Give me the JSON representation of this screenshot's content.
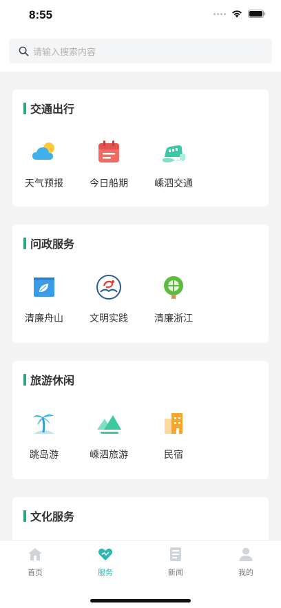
{
  "status_bar": {
    "time": "8:55"
  },
  "search": {
    "placeholder": "请输入搜索内容"
  },
  "sections": [
    {
      "title": "交通出行",
      "items": [
        {
          "label": "天气预报",
          "icon": "weather-icon"
        },
        {
          "label": "今日船期",
          "icon": "calendar-icon"
        },
        {
          "label": "嵊泗交通",
          "icon": "ship-icon"
        }
      ]
    },
    {
      "title": "问政服务",
      "items": [
        {
          "label": "清廉舟山",
          "icon": "leaf-window-icon"
        },
        {
          "label": "文明实践",
          "icon": "civility-logo-icon"
        },
        {
          "label": "清廉浙江",
          "icon": "clean-zhejiang-icon"
        }
      ]
    },
    {
      "title": "旅游休闲",
      "items": [
        {
          "label": "跳岛游",
          "icon": "palm-tree-icon"
        },
        {
          "label": "嵊泗旅游",
          "icon": "mountain-icon"
        },
        {
          "label": "民宿",
          "icon": "building-icon"
        }
      ]
    },
    {
      "title": "文化服务",
      "items": []
    }
  ],
  "tabbar": [
    {
      "label": "首页",
      "icon": "home-icon",
      "active": false
    },
    {
      "label": "服务",
      "icon": "heart-service-icon",
      "active": true
    },
    {
      "label": "新闻",
      "icon": "news-icon",
      "active": false
    },
    {
      "label": "我的",
      "icon": "user-icon",
      "active": false
    }
  ],
  "colors": {
    "accent_green": "#2fa57a",
    "active_tab": "#2bb7b3",
    "background": "#f4f4f5"
  }
}
